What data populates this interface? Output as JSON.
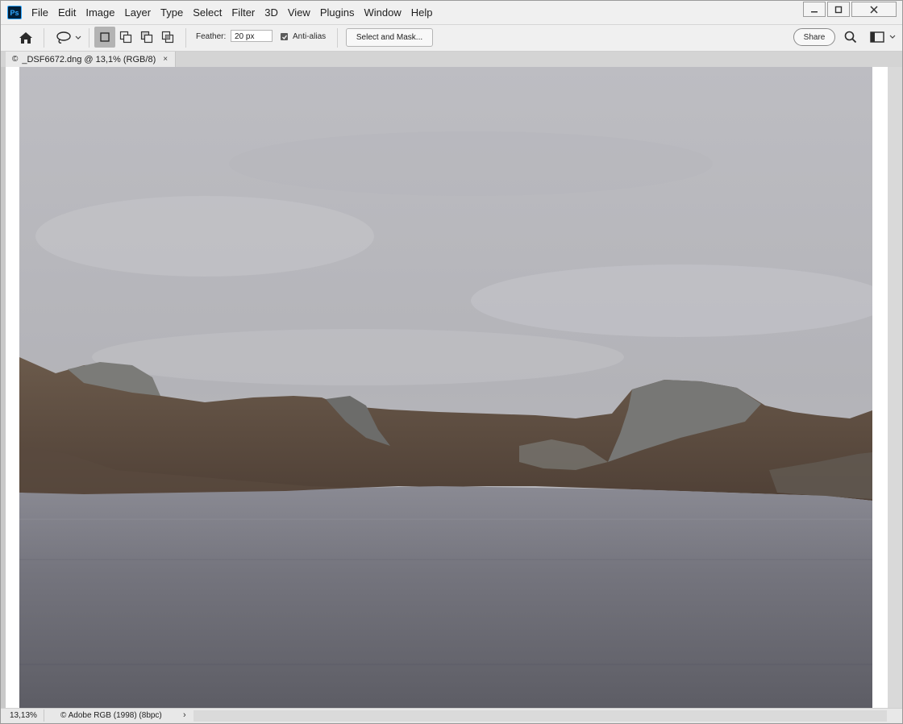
{
  "app": {
    "logo_text": "Ps"
  },
  "menu": [
    "File",
    "Edit",
    "Image",
    "Layer",
    "Type",
    "Select",
    "Filter",
    "3D",
    "View",
    "Plugins",
    "Window",
    "Help"
  ],
  "window_controls": {
    "minimize_icon": "minimize-icon",
    "maximize_icon": "maximize-icon",
    "close_icon": "close-icon"
  },
  "options_bar": {
    "home_icon": "home-icon",
    "tool_icon": "lasso-icon",
    "selection_modes": [
      "new-selection",
      "add-to-selection",
      "subtract-from-selection",
      "intersect-with-selection"
    ],
    "active_mode": "new-selection",
    "feather_label": "Feather:",
    "feather_value": "20 px",
    "anti_alias_label": "Anti-alias",
    "anti_alias_checked": true,
    "select_and_mask_label": "Select and Mask...",
    "share_label": "Share",
    "search_icon": "search-icon",
    "workspace_icon": "workspace-icon"
  },
  "document": {
    "tab_prefix": "©",
    "tab_title": "_DSF6672.dng @ 13,1% (RGB/8)",
    "tab_close": "×"
  },
  "status": {
    "zoom": "13,13%",
    "profile": "© Adobe RGB (1998) (8bpc)",
    "arrow": "›"
  },
  "colors": {
    "sky": "#bcbcc0",
    "water": "#6e6e77",
    "hills": "#5b4a3c",
    "rock": "#7e7e7c"
  }
}
